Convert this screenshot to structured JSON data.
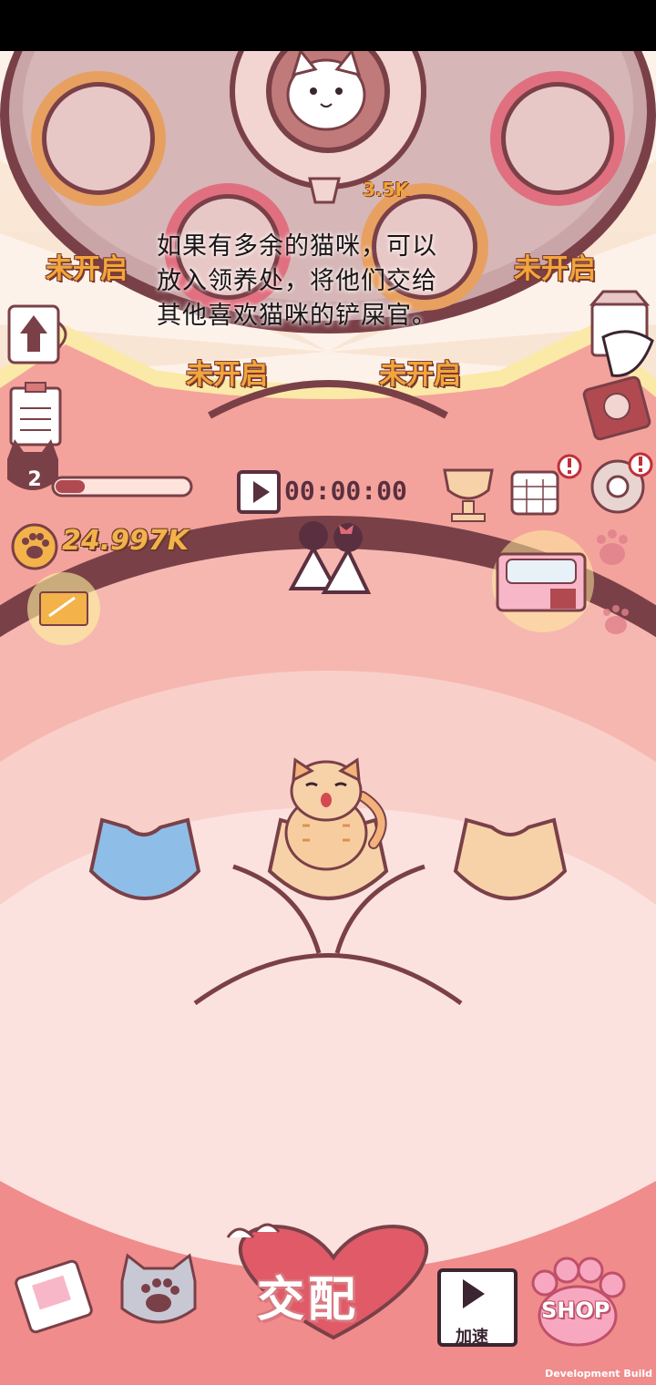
{
  "hud": {
    "level": "2",
    "coins": "24.997K",
    "timer": "00:00:00",
    "income": "3.5K",
    "xp_fraction": 0.22
  },
  "adoption": {
    "locked_label_1": "未开启",
    "locked_label_2": "未开启",
    "locked_label_3": "未开启",
    "locked_label_4": "未开启",
    "tip_line_1": "如果有多余的猫咪，可以",
    "tip_line_2": "放入领养处，将他们交给",
    "tip_line_3": "其他喜欢猫咪的铲屎官。"
  },
  "bottom_bar": {
    "mate_label": "交配",
    "speedup_label": "加速",
    "shop_label": "SHOP"
  },
  "footer": {
    "build_label": "Development Build"
  },
  "colors": {
    "pink_main": "#f7a8a0",
    "pink_light": "#fbd9d5",
    "brown_outline": "#7a4048",
    "coin_gold": "#f3b24a"
  },
  "icons": [
    "upgrade-cup-icon",
    "task-list-icon",
    "milk-carton-icon",
    "secret-book-icon",
    "trophy-icon",
    "calendar-icon",
    "settings-gear-icon",
    "claw-machine-icon",
    "paw-coin-icon",
    "gift-box-icon",
    "couple-icon",
    "video-play-icon",
    "album-icon",
    "cat-tag-icon",
    "shop-paw-icon",
    "heart-icon"
  ]
}
